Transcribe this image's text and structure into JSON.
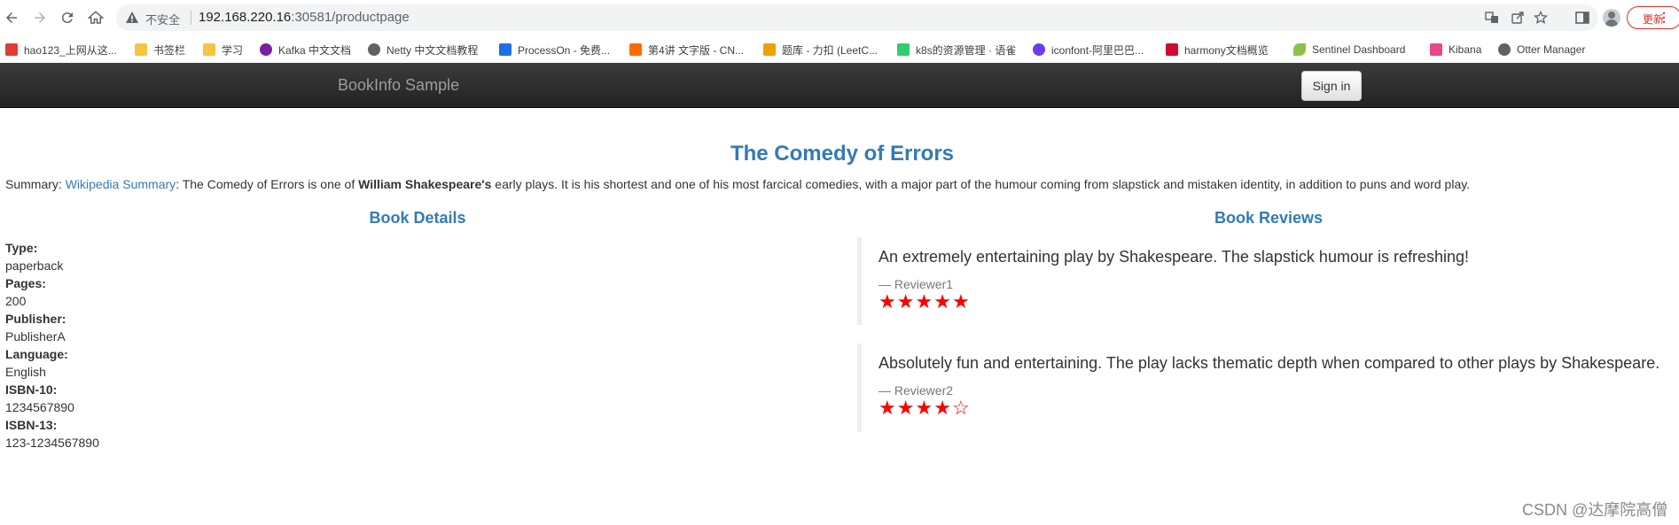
{
  "browser": {
    "security_label": "不安全",
    "url_host": "192.168.220.16",
    "url_rest": ":30581/productpage",
    "update_label": "更新"
  },
  "bookmarks": [
    {
      "label": "hao123_上网从这...",
      "icon": "hao123-icon",
      "color": "#e53935"
    },
    {
      "label": "书签栏",
      "icon": "folder-icon",
      "color": "#f6c342"
    },
    {
      "label": "学习",
      "icon": "folder-icon",
      "color": "#f6c342"
    },
    {
      "label": "Kafka 中文文档",
      "icon": "kafka-icon",
      "color": "#7b1fa2"
    },
    {
      "label": "Netty 中文文档教程",
      "icon": "netty-icon",
      "color": "#5f6368"
    },
    {
      "label": "ProcessOn - 免费...",
      "icon": "processon-icon",
      "color": "#1e6fe6"
    },
    {
      "label": "第4讲 文字版 - CN...",
      "icon": "csdn-icon",
      "color": "#ff6a00"
    },
    {
      "label": "题库 - 力扣 (LeetC...",
      "icon": "leetcode-icon",
      "color": "#f0a000"
    },
    {
      "label": "k8s的资源管理 · 语雀",
      "icon": "yuque-icon",
      "color": "#31cc6e"
    },
    {
      "label": "iconfont-阿里巴巴...",
      "icon": "iconfont-icon",
      "color": "#6a3de8"
    },
    {
      "label": "harmony文档概览",
      "icon": "huawei-icon",
      "color": "#cf0a2c"
    },
    {
      "label": "Sentinel Dashboard",
      "icon": "sentinel-icon",
      "color": "#8bc34a"
    },
    {
      "label": "Kibana",
      "icon": "kibana-icon",
      "color": "#e8488b"
    },
    {
      "label": "Otter Manager",
      "icon": "globe-icon",
      "color": "#5f6368"
    }
  ],
  "navbar": {
    "brand": "BookInfo Sample",
    "signin_label": "Sign in"
  },
  "product": {
    "title": "The Comedy of Errors",
    "summary_prefix": "Summary: ",
    "summary_link": "Wikipedia Summary",
    "summary_text_1": ": The Comedy of Errors is one of ",
    "summary_bold": "William Shakespeare's",
    "summary_text_2": " early plays. It is his shortest and one of his most farcical comedies, with a major part of the humour coming from slapstick and mistaken identity, in addition to puns and word play."
  },
  "details": {
    "heading": "Book Details",
    "items": [
      {
        "label": "Type:",
        "value": "paperback"
      },
      {
        "label": "Pages:",
        "value": "200"
      },
      {
        "label": "Publisher:",
        "value": "PublisherA"
      },
      {
        "label": "Language:",
        "value": "English"
      },
      {
        "label": "ISBN-10:",
        "value": "1234567890"
      },
      {
        "label": "ISBN-13:",
        "value": "123-1234567890"
      }
    ]
  },
  "reviews": {
    "heading": "Book Reviews",
    "items": [
      {
        "text": "An extremely entertaining play by Shakespeare. The slapstick humour is refreshing!",
        "reviewer": "— Reviewer1",
        "rating": 5,
        "max_rating": 5,
        "star_color": "#ff0000"
      },
      {
        "text": "Absolutely fun and entertaining. The play lacks thematic depth when compared to other plays by Shakespeare.",
        "reviewer": "— Reviewer2",
        "rating": 4,
        "max_rating": 5,
        "star_color": "#ff0000"
      }
    ]
  },
  "watermark": "CSDN @达摩院高僧"
}
